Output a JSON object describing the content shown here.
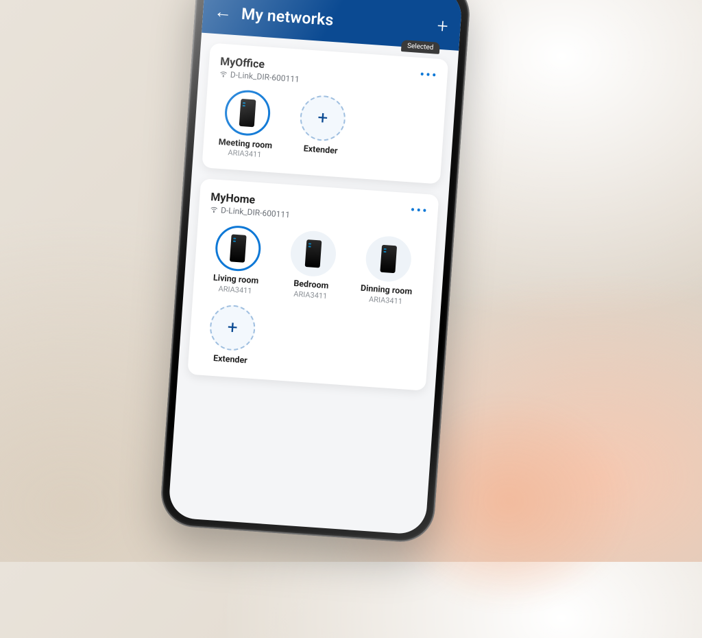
{
  "header": {
    "title": "My networks",
    "selected_badge": "Selected"
  },
  "networks": [
    {
      "name": "MyOffice",
      "ssid": "D-Link_DIR-600111",
      "devices": [
        {
          "name": "Meeting room",
          "model": "ARIA3411",
          "primary": true
        }
      ],
      "extender_label": "Extender"
    },
    {
      "name": "MyHome",
      "ssid": "D-Link_DIR-600111",
      "devices": [
        {
          "name": "Living room",
          "model": "ARIA3411",
          "primary": true
        },
        {
          "name": "Bedroom",
          "model": "ARIA3411",
          "primary": false
        },
        {
          "name": "Dinning room",
          "model": "ARIA3411",
          "primary": false
        }
      ],
      "extender_label": "Extender"
    }
  ]
}
